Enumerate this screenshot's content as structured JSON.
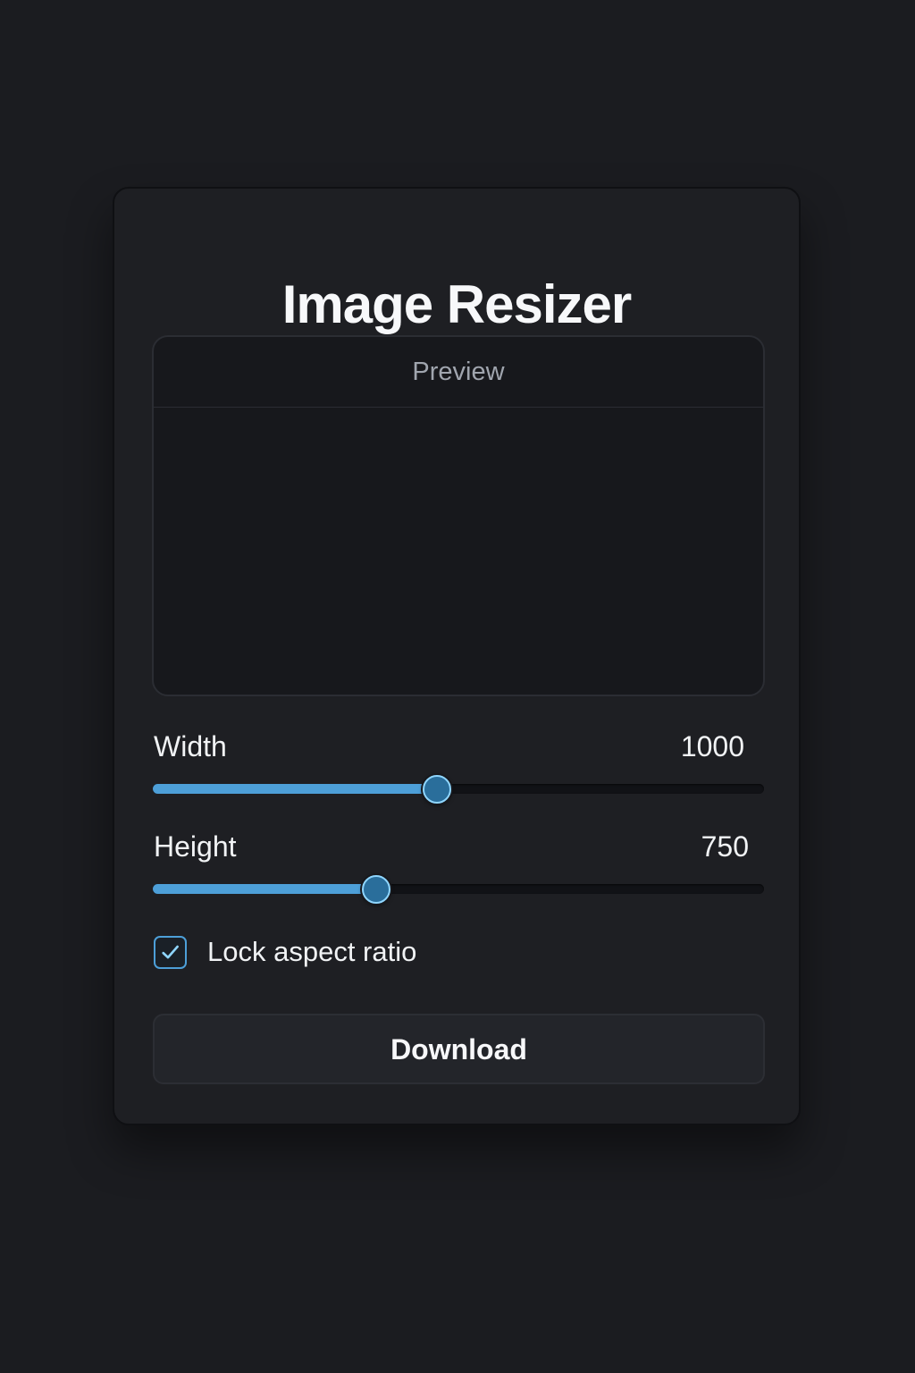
{
  "app": {
    "title": "Image Resizer"
  },
  "preview": {
    "label": "Preview"
  },
  "controls": {
    "width": {
      "label": "Width",
      "value": "1000",
      "slider_fraction": 0.465
    },
    "height": {
      "label": "Height",
      "value": "750",
      "slider_fraction": 0.365
    },
    "lock_aspect_ratio": {
      "label": "Lock aspect ratio",
      "checked": true
    }
  },
  "actions": {
    "download_label": "Download"
  },
  "colors": {
    "background": "#1b1c20",
    "card": "#1e1f23",
    "accent": "#4d9fd8",
    "thumb": "#2a6e9b",
    "muted_text": "#a0a5ae"
  },
  "icons": {
    "checkbox": "check-icon"
  }
}
